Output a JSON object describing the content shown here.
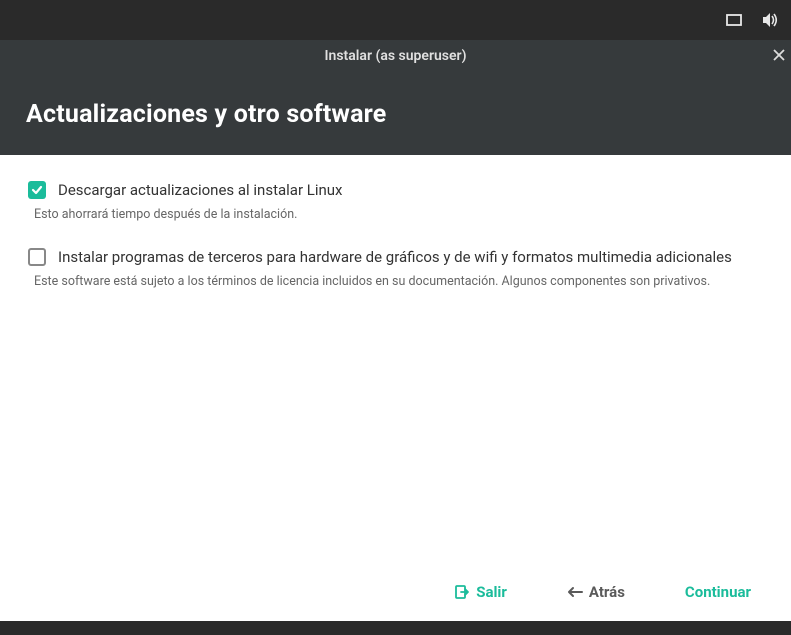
{
  "titlebar": {
    "title": "Instalar (as superuser)"
  },
  "header": {
    "page_title": "Actualizaciones y otro software"
  },
  "options": {
    "download_updates": {
      "checked": true,
      "label": "Descargar actualizaciones al instalar Linux",
      "description": "Esto ahorrará tiempo después de la instalación."
    },
    "third_party": {
      "checked": false,
      "label": "Instalar programas de terceros para hardware de gráficos y de wifi y formatos multimedia adicionales",
      "description": "Este software está sujeto a los términos de licencia incluidos en su documentación. Algunos componentes son privativos."
    }
  },
  "footer": {
    "quit": "Salir",
    "back": "Atrás",
    "continue": "Continuar"
  },
  "colors": {
    "accent": "#1bbc9b",
    "header_bg": "#363a3c",
    "panel_bg": "#2a2a2a"
  }
}
